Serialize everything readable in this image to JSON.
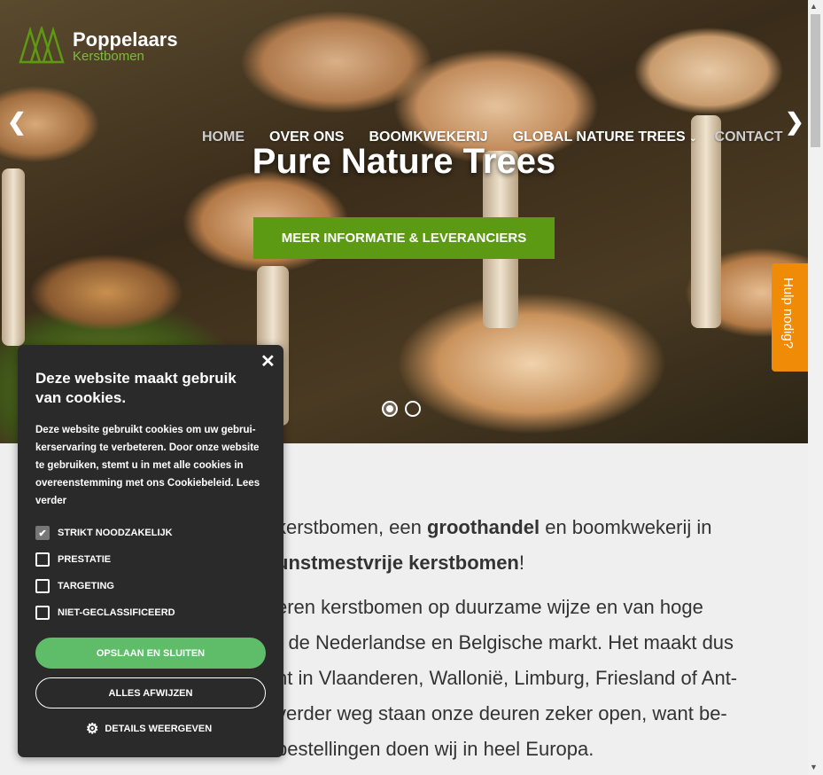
{
  "brand": {
    "title": "Poppelaars",
    "subtitle": "Kerstbomen"
  },
  "nav": {
    "items": [
      {
        "label": "HOME"
      },
      {
        "label": "OVER ONS"
      },
      {
        "label": "BOOMKWEKERIJ"
      },
      {
        "label": "GLOBAL NATURE TREES"
      },
      {
        "label": "CONTACT"
      }
    ]
  },
  "hero": {
    "title": "Pure Nature Trees",
    "cta": "MEER INFORMATIE & LEVERANCIERS",
    "slide_count": 2,
    "active_slide": 1
  },
  "help": {
    "label": "Hulp nodig?"
  },
  "content": {
    "p1_a": "kerstbomen, een ",
    "p1_b": "groothandel",
    "p1_c": " en boomkwekerij in",
    "p1_d": "unstmestvrije kerstbomen",
    "p1_e": "!",
    "p2_l1": "eren kerstbomen op duurzame wijze en van hoge",
    "p2_l2": "r de Nederlandse en Belgische markt. Het maakt dus",
    "p2_l3": "nt in Vlaanderen, Wallonië, Limburg, Friesland of Ant-",
    "p2_l4": "verder weg staan onze deuren zeker open, want be-",
    "p2_l5": "bestellingen doen wij in heel Europa."
  },
  "cookie": {
    "title": "Deze website maakt gebruik van cookies.",
    "description": "Deze website gebruikt cookies om uw gebrui-kerservaring te verbeteren. Door onze website te gebruiken, stemt u in met alle cookies in overeenstemming met ons Cookiebeleid.",
    "read_more": "Lees verder",
    "options": [
      {
        "label": "STRIKT NOODZAKELIJK",
        "checked": true
      },
      {
        "label": "PRESTATIE",
        "checked": false
      },
      {
        "label": "TARGETING",
        "checked": false
      },
      {
        "label": "NIET-GECLASSIFICEERD",
        "checked": false
      }
    ],
    "save_label": "OPSLAAN EN SLUITEN",
    "reject_label": "ALLES AFWIJZEN",
    "details_label": "DETAILS WEERGEVEN"
  },
  "colors": {
    "accent_green": "#5d9a14",
    "help_orange": "#f08b08",
    "cookie_bg": "#2a2a2a",
    "save_green": "#5fbd6a"
  }
}
